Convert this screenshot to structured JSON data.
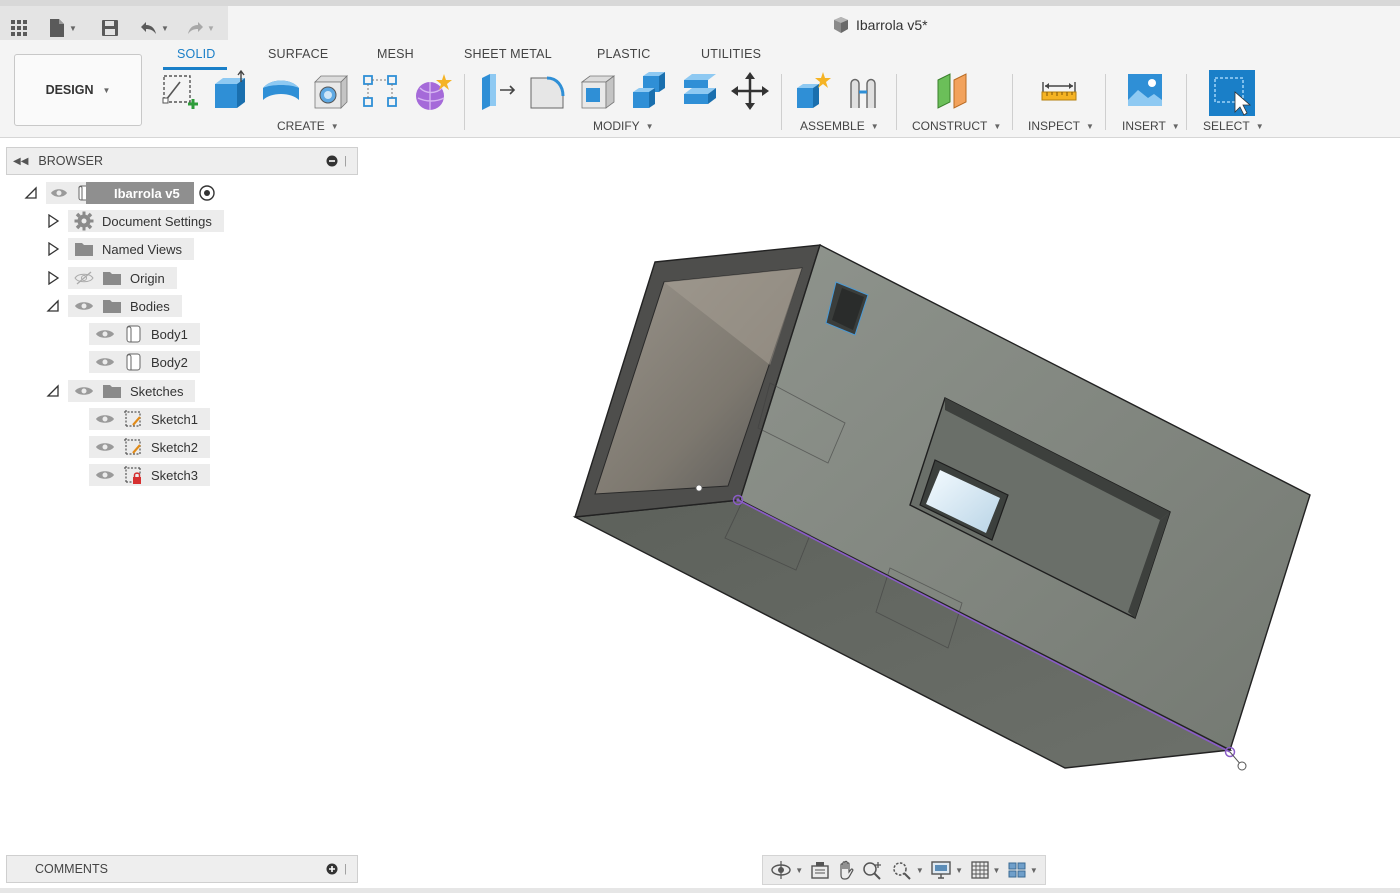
{
  "app": {
    "title": "Ibarrola v5*"
  },
  "tabs": [
    {
      "label": "SOLID",
      "active": true
    },
    {
      "label": "SURFACE"
    },
    {
      "label": "MESH"
    },
    {
      "label": "SHEET METAL"
    },
    {
      "label": "PLASTIC"
    },
    {
      "label": "UTILITIES"
    }
  ],
  "workspace": {
    "label": "DESIGN"
  },
  "groups": {
    "create": "CREATE",
    "modify": "MODIFY",
    "assemble": "ASSEMBLE",
    "construct": "CONSTRUCT",
    "inspect": "INSPECT",
    "insert": "INSERT",
    "select": "SELECT"
  },
  "browser": {
    "title": "BROWSER",
    "root": "Ibarrola v5",
    "items": {
      "document_settings": "Document Settings",
      "named_views": "Named Views",
      "origin": "Origin",
      "bodies": "Bodies",
      "body1": "Body1",
      "body2": "Body2",
      "sketches": "Sketches",
      "sketch1": "Sketch1",
      "sketch2": "Sketch2",
      "sketch3": "Sketch3"
    }
  },
  "comments": {
    "title": "COMMENTS"
  },
  "colors": {
    "accent": "#1a7fc8",
    "body_face": "#7d827b",
    "sketch_line": "#8a5cc7"
  }
}
